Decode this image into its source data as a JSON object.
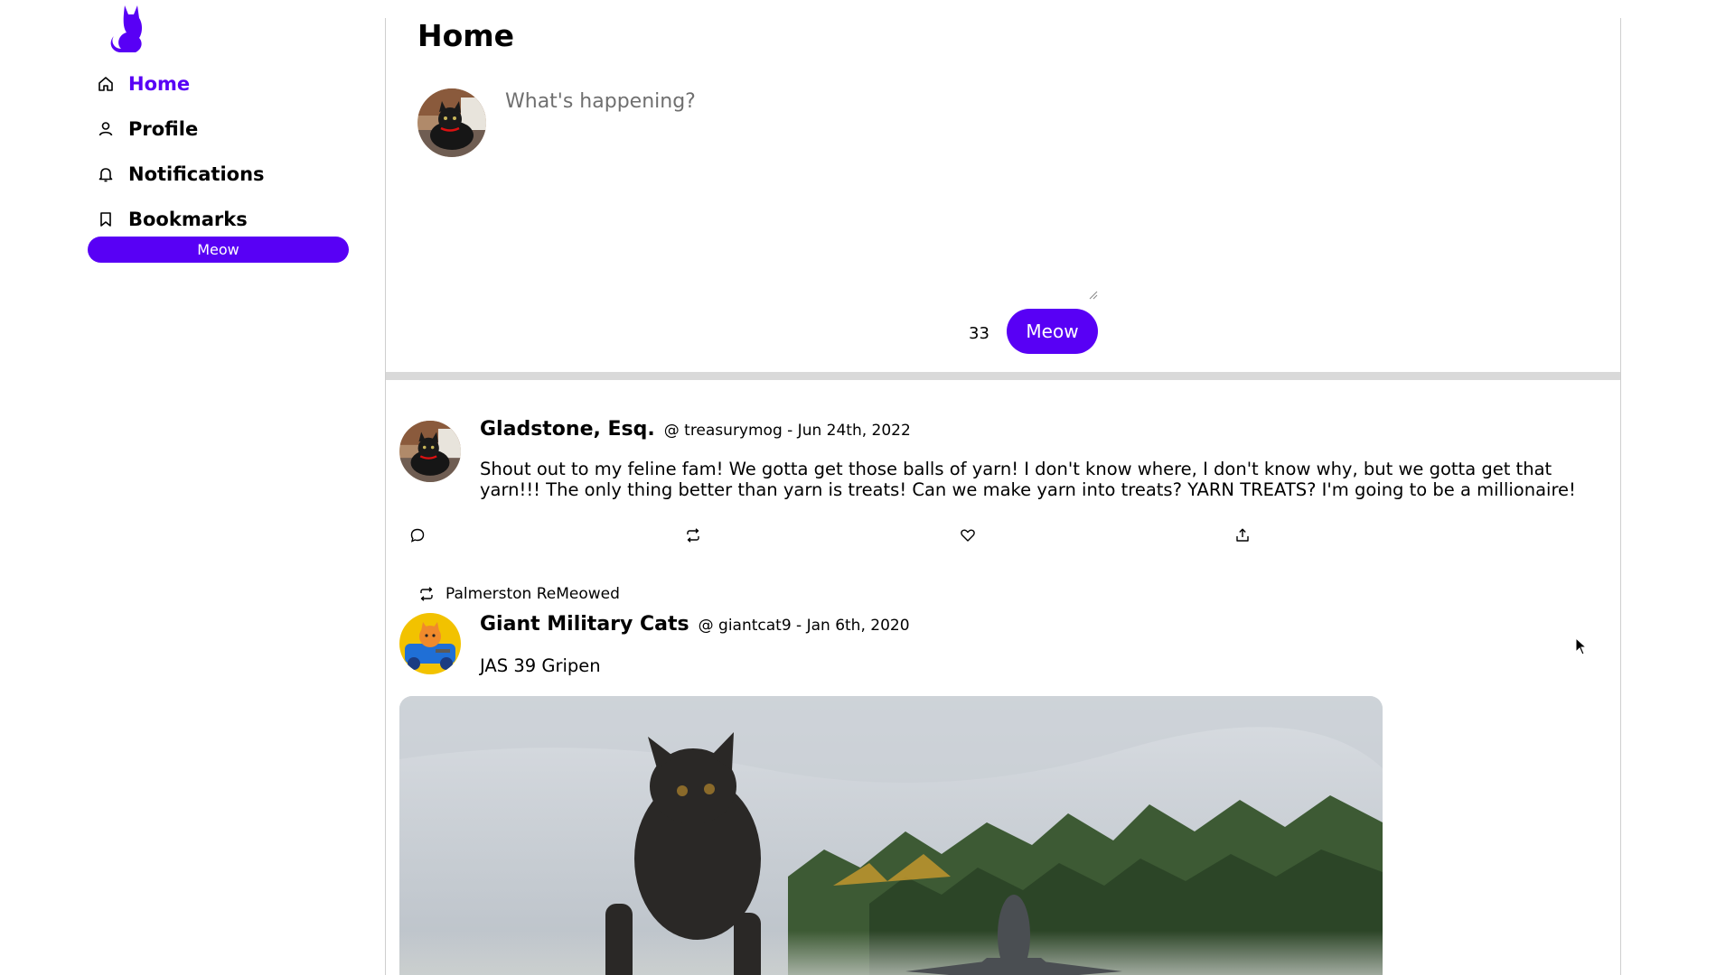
{
  "sidebar": {
    "logo_icon": "cat-logo-icon",
    "items": [
      {
        "label": "Home",
        "icon": "home-icon",
        "active": true
      },
      {
        "label": "Profile",
        "icon": "user-icon",
        "active": false
      },
      {
        "label": "Notifications",
        "icon": "bell-icon",
        "active": false
      },
      {
        "label": "Bookmarks",
        "icon": "bookmark-icon",
        "active": false
      }
    ],
    "meow_button": "Meow"
  },
  "main": {
    "title": "Home",
    "composer": {
      "placeholder": "What's happening?",
      "value": "",
      "char_count": "33",
      "submit_label": "Meow"
    },
    "posts": [
      {
        "name": "Gladstone, Esq.",
        "meta": "@ treasurymog - Jun 24th, 2022",
        "body": "Shout out to my feline fam! We gotta get those balls of yarn! I don't know where, I don't know why, but we gotta get that yarn!!! The only thing better than yarn is treats! Can we make yarn into treats? YARN TREATS? I'm going to be a millionaire!",
        "actions": [
          "comment-icon",
          "remeow-icon",
          "heart-icon",
          "share-icon"
        ]
      },
      {
        "remeow_by": "Palmerston ReMeowed",
        "name": "Giant Military Cats",
        "meta": "@ giantcat9 - Jan 6th, 2020",
        "body": "JAS 39 Gripen",
        "image": "cat-and-fighter-jet-photo"
      }
    ]
  },
  "colors": {
    "accent": "#5800f5",
    "divider": "#d9d9d9",
    "border": "#cfcfcf"
  }
}
